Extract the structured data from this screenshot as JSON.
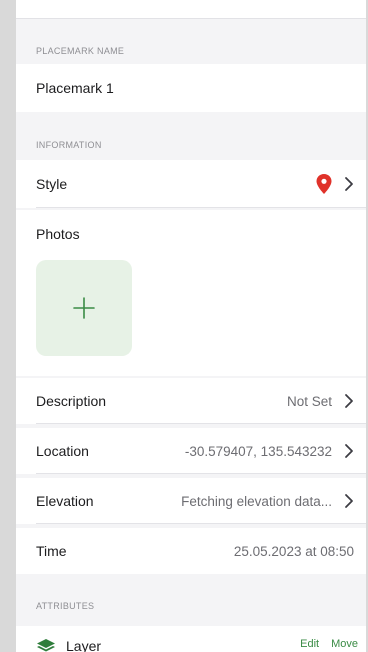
{
  "sections": {
    "placemark_name": "PLACEMARK NAME",
    "information": "INFORMATION",
    "attributes": "ATTRIBUTES"
  },
  "placemark": {
    "name": "Placemark 1"
  },
  "info": {
    "style_label": "Style",
    "photos_label": "Photos",
    "description_label": "Description",
    "description_value": "Not Set",
    "location_label": "Location",
    "location_value": "-30.579407, 135.543232",
    "elevation_label": "Elevation",
    "elevation_value": "Fetching elevation data...",
    "time_label": "Time",
    "time_value": "25.05.2023 at 08:50"
  },
  "attributes": {
    "layer_label": "Layer",
    "edit_label": "Edit",
    "move_label": "Move"
  },
  "colors": {
    "accent_green": "#3a8b45",
    "pin_red": "#e0322a",
    "photo_tile": "#e7f2e6"
  },
  "icons": {
    "style": "map-pin-icon",
    "add_photo": "plus-icon",
    "layer": "layers-icon",
    "chevron": "chevron-right-icon"
  }
}
